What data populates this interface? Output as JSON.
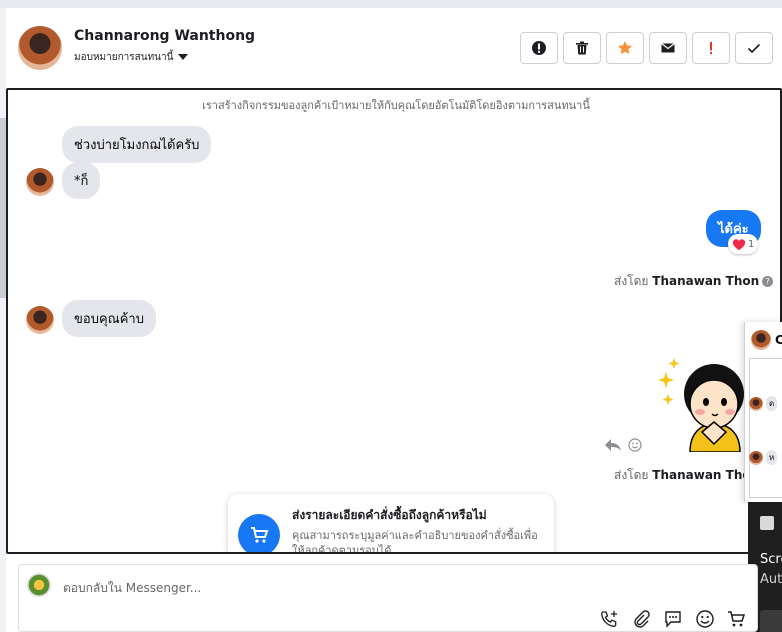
{
  "header": {
    "contact_name": "Channarong Wanthong",
    "assign_label": "มอบหมายการสนทนานี้",
    "actions": [
      {
        "name": "spam",
        "icon": "exclamation-circle-icon"
      },
      {
        "name": "delete",
        "icon": "trash-icon"
      },
      {
        "name": "star",
        "icon": "star-icon"
      },
      {
        "name": "mark-unread",
        "icon": "envelope-icon"
      },
      {
        "name": "follow-up",
        "icon": "exclamation-icon"
      },
      {
        "name": "done",
        "icon": "check-icon"
      }
    ]
  },
  "conversation": {
    "system_note": "เราสร้างกิจกรรมของลูกค้าเป้าหมายให้กับคุณโดยอัตโนมัติโดยอิงตามการสนทนานี้",
    "messages": [
      {
        "text": "ช่วงบ่ายโมงกฌได้ครับ"
      },
      {
        "text": "*ก็"
      },
      {
        "text": "ได้ค่ะ",
        "reaction_count": "1"
      },
      {
        "text": "ขอบคุณค้าบ"
      }
    ],
    "sent_by_label": "ส่งโดย",
    "sender_name": "Thanawan Thon",
    "sender_name_2": "Thanawan Thon"
  },
  "order_card": {
    "title": "ส่งรายละเอียดคำสั่งซื้อถึงลูกค้าหรือไม่",
    "description": "คุณสามารถระบุมูลค่าและคำอธิบายของคำสั่งซื้อเพื่อให้ลูกค้าดูตามรอบได้"
  },
  "popup": {
    "title_initial": "C",
    "chip_1": "ด",
    "chip_2": "ห"
  },
  "toast": {
    "line1": "Screenshot",
    "line2": "Automatically saved"
  },
  "composer": {
    "placeholder": "ตอบกลับใน Messenger..."
  },
  "colors": {
    "accent": "#1877f2",
    "star": "#f7923a",
    "follow_up": "#e4392f"
  }
}
